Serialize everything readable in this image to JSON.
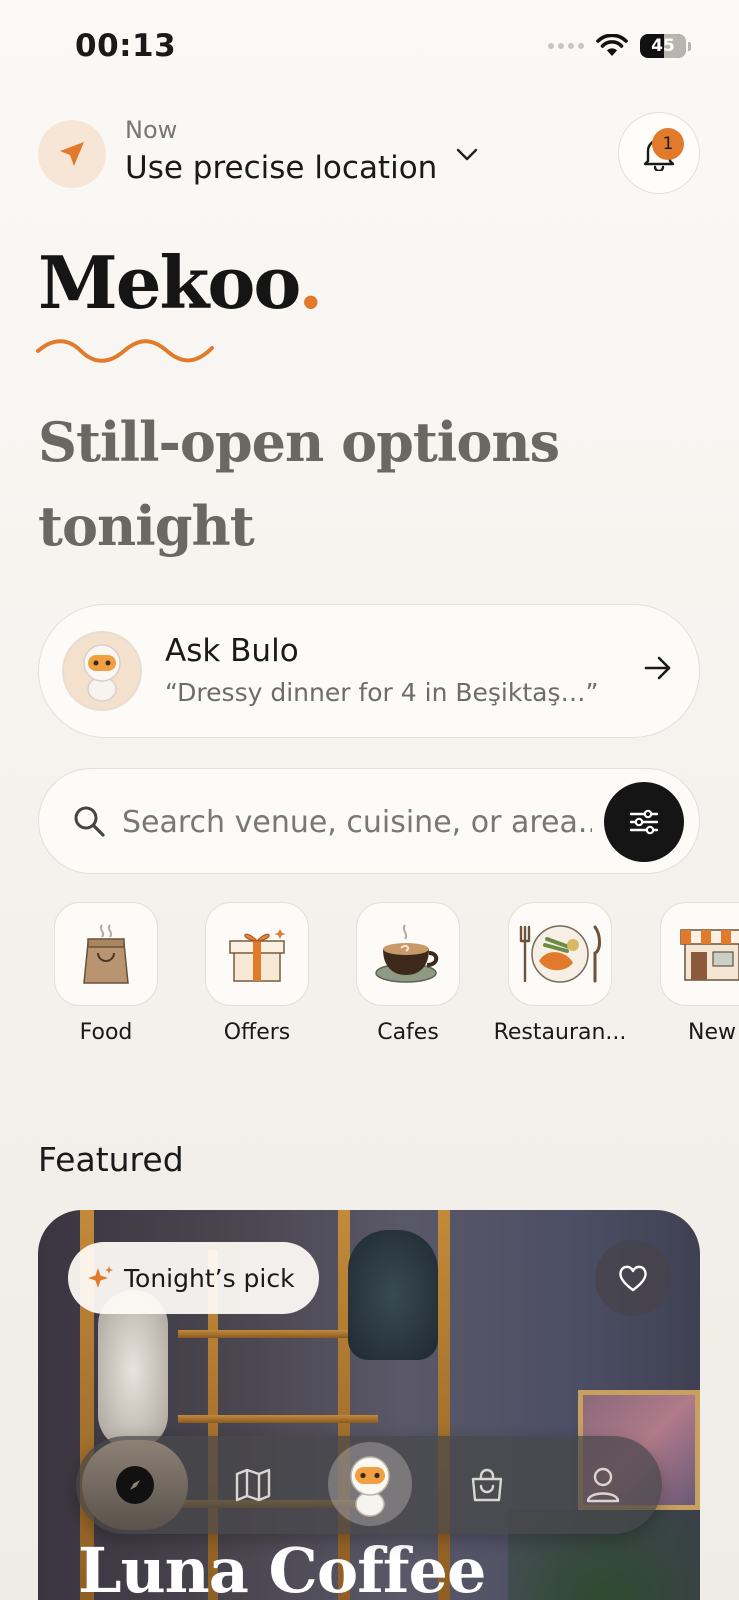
{
  "status_bar": {
    "time": "00:13",
    "battery": "45"
  },
  "location": {
    "label_small": "Now",
    "label_main": "Use precise location",
    "notification_count": "1"
  },
  "brand": {
    "name": "Mekoo",
    "dot": "."
  },
  "headline": "Still-open options tonight",
  "ask": {
    "title": "Ask Bulo",
    "subtitle": "“Dressy dinner for 4 in Beşiktaş…”"
  },
  "search": {
    "placeholder": "Search venue, cuisine, or area..."
  },
  "categories": [
    {
      "label": "Food",
      "icon": "food-bag-icon"
    },
    {
      "label": "Offers",
      "icon": "gift-icon"
    },
    {
      "label": "Cafes",
      "icon": "coffee-cup-icon"
    },
    {
      "label": "Restauran...",
      "icon": "dinner-plate-icon"
    },
    {
      "label": "New",
      "icon": "storefront-icon"
    }
  ],
  "featured": {
    "section_title": "Featured",
    "badge": "Tonight’s pick",
    "venue_name": "Luna Coffee"
  },
  "tabbar": {
    "tabs": [
      "compass-icon",
      "map-icon",
      "bulo-icon",
      "bag-icon",
      "profile-icon"
    ]
  },
  "colors": {
    "accent": "#e27a2b",
    "dark": "#151515",
    "card": "#fdfbf8"
  }
}
